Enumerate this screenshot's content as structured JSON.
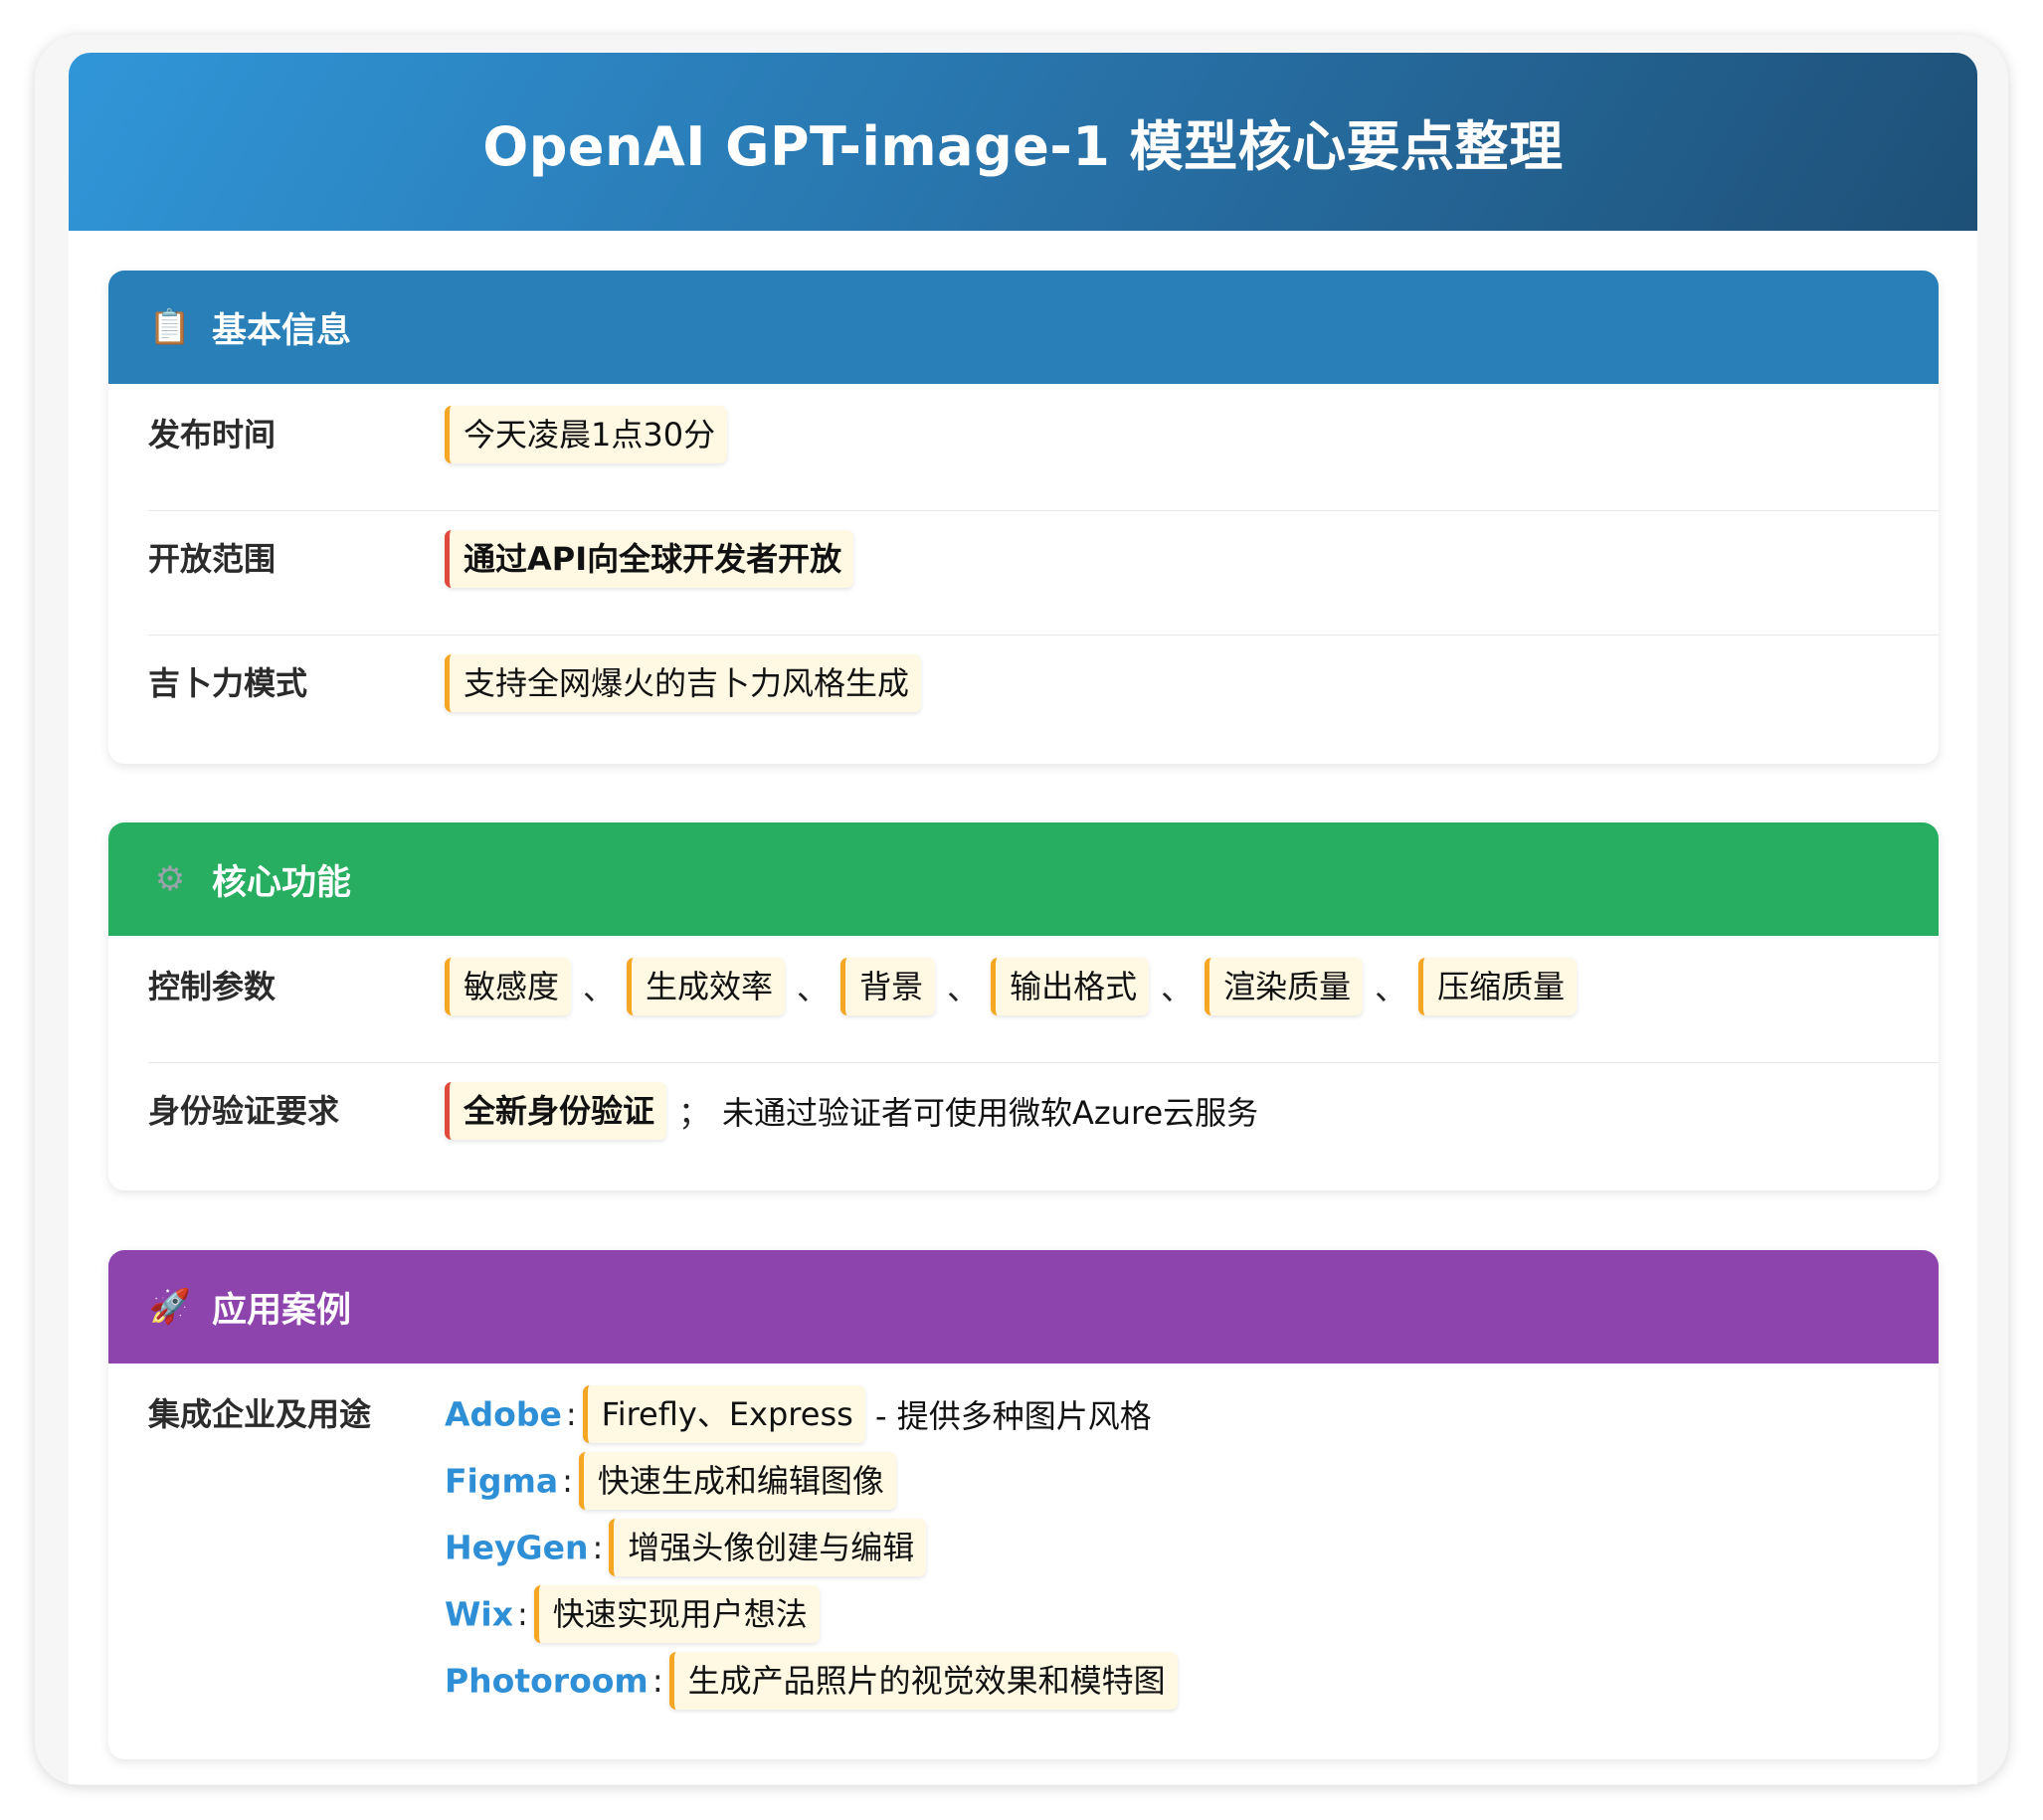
{
  "title": "OpenAI GPT-image-1 模型核心要点整理",
  "colors": {
    "basic": "#2980b9",
    "core": "#27ae60",
    "apps": "#8e44ad",
    "accent_tag": "#f5a623",
    "highlight_tag": "#e04a3c",
    "company": "#2f8fd6"
  },
  "basic": {
    "icon": "clipboard-icon",
    "title": "基本信息",
    "release_label": "发布时间",
    "release_value": "今天凌晨1点30分",
    "scope_label": "开放范围",
    "scope_value": "通过API向全球开发者开放",
    "ghibli_label": "吉卜力模式",
    "ghibli_value": "支持全网爆火的吉卜力风格生成"
  },
  "core": {
    "icon": "gear-icon",
    "title": "核心功能",
    "params_label": "控制参数",
    "params": [
      "敏感度",
      "生成效率",
      "背景",
      "输出格式",
      "渲染质量",
      "压缩质量"
    ],
    "separator": "、",
    "auth_label": "身份验证要求",
    "auth_tag": "全新身份验证",
    "auth_sep": "；",
    "auth_text": "未通过验证者可使用微软Azure云服务"
  },
  "apps": {
    "icon": "rocket-icon",
    "title": "应用案例",
    "label": "集成企业及用途",
    "colon": ":",
    "companies": [
      {
        "name": "Adobe",
        "use": "Firefly、Express",
        "extra": " - 提供多种图片风格"
      },
      {
        "name": "Figma",
        "use": "快速生成和编辑图像",
        "extra": ""
      },
      {
        "name": "HeyGen",
        "use": "增强头像创建与编辑",
        "extra": ""
      },
      {
        "name": "Wix",
        "use": "快速实现用户想法",
        "extra": ""
      },
      {
        "name": "Photoroom",
        "use": "生成产品照片的视觉效果和模特图",
        "extra": ""
      }
    ]
  }
}
